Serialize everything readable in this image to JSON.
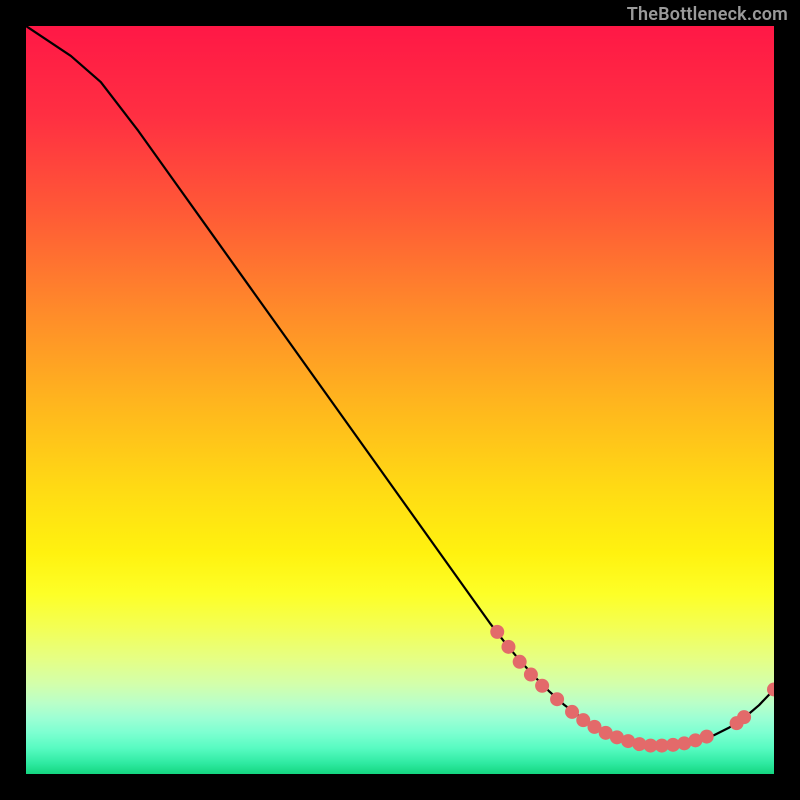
{
  "watermark": "TheBottleneck.com",
  "chart_data": {
    "type": "line",
    "title": "",
    "xlabel": "",
    "ylabel": "",
    "xlim": [
      0,
      100
    ],
    "ylim": [
      0,
      100
    ],
    "x": [
      0,
      6,
      10,
      15,
      20,
      25,
      30,
      35,
      40,
      45,
      50,
      55,
      60,
      62,
      64,
      66,
      68,
      70,
      72,
      74,
      76,
      78,
      80,
      82,
      84,
      86,
      88,
      90,
      92,
      94,
      96,
      98,
      100
    ],
    "y": [
      100,
      96,
      92.5,
      86,
      79,
      72,
      65,
      58,
      51,
      44,
      37,
      30,
      23,
      20.2,
      17.6,
      15.2,
      13,
      11,
      9.2,
      7.7,
      6.4,
      5.3,
      4.5,
      4,
      3.8,
      3.8,
      4,
      4.5,
      5.2,
      6.2,
      7.5,
      9.2,
      11.3
    ],
    "dots": [
      {
        "x": 63,
        "y": 19
      },
      {
        "x": 64.5,
        "y": 17
      },
      {
        "x": 66,
        "y": 15
      },
      {
        "x": 67.5,
        "y": 13.3
      },
      {
        "x": 69,
        "y": 11.8
      },
      {
        "x": 71,
        "y": 10
      },
      {
        "x": 73,
        "y": 8.3
      },
      {
        "x": 74.5,
        "y": 7.2
      },
      {
        "x": 76,
        "y": 6.3
      },
      {
        "x": 77.5,
        "y": 5.5
      },
      {
        "x": 79,
        "y": 4.9
      },
      {
        "x": 80.5,
        "y": 4.4
      },
      {
        "x": 82,
        "y": 4.0
      },
      {
        "x": 83.5,
        "y": 3.8
      },
      {
        "x": 85,
        "y": 3.8
      },
      {
        "x": 86.5,
        "y": 3.9
      },
      {
        "x": 88,
        "y": 4.1
      },
      {
        "x": 89.5,
        "y": 4.5
      },
      {
        "x": 91,
        "y": 5.0
      },
      {
        "x": 95,
        "y": 6.8
      },
      {
        "x": 96,
        "y": 7.6
      },
      {
        "x": 100,
        "y": 11.3
      }
    ],
    "gradient_stops": [
      {
        "pos": 0.0,
        "color": "#ff1846"
      },
      {
        "pos": 0.12,
        "color": "#ff2f42"
      },
      {
        "pos": 0.25,
        "color": "#ff5a36"
      },
      {
        "pos": 0.38,
        "color": "#ff8a2a"
      },
      {
        "pos": 0.5,
        "color": "#ffb41e"
      },
      {
        "pos": 0.62,
        "color": "#ffdb14"
      },
      {
        "pos": 0.705,
        "color": "#fff20f"
      },
      {
        "pos": 0.76,
        "color": "#fdff27"
      },
      {
        "pos": 0.805,
        "color": "#f3ff55"
      },
      {
        "pos": 0.845,
        "color": "#e6ff83"
      },
      {
        "pos": 0.88,
        "color": "#d3ffab"
      },
      {
        "pos": 0.905,
        "color": "#baffc8"
      },
      {
        "pos": 0.925,
        "color": "#9dffd4"
      },
      {
        "pos": 0.945,
        "color": "#7cffd1"
      },
      {
        "pos": 0.965,
        "color": "#58fbc2"
      },
      {
        "pos": 0.985,
        "color": "#2feaa2"
      },
      {
        "pos": 1.0,
        "color": "#14d680"
      }
    ],
    "curve_color": "#000000",
    "dot_color": "#e36a6a",
    "dot_radius": 7
  }
}
